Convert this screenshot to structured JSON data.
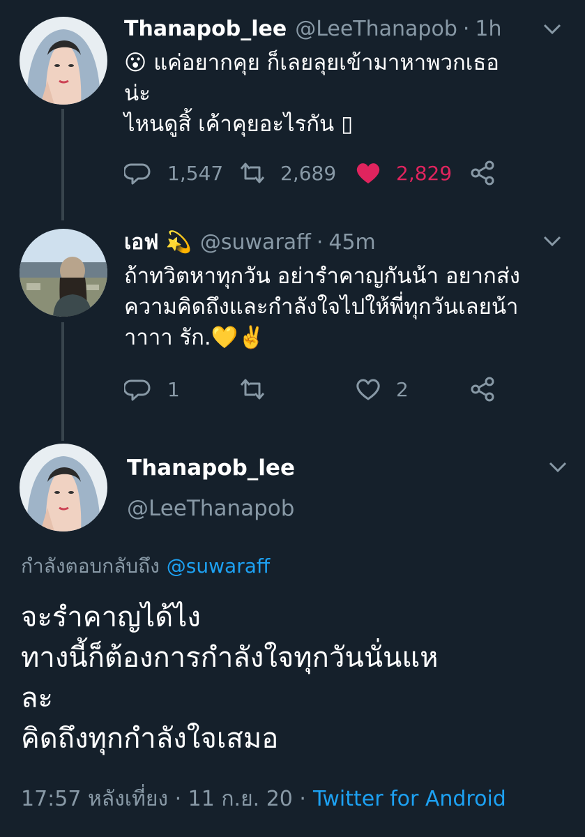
{
  "tweet1": {
    "display_name": "Thanapob_lee",
    "handle": "@LeeThanapob",
    "sep": "·",
    "time": "1h",
    "emoji": "😮",
    "lines": [
      "แค่อยากคุย ก็เลยลุยเข้ามาหาพวกเธอ",
      "น่ะ",
      "ไหนดูสิ้ เค้าคุยอะไรกัน ▯"
    ],
    "replies": "1,547",
    "retweets": "2,689",
    "likes": "2,829",
    "liked": true
  },
  "tweet2": {
    "display_name": "เอฟ",
    "name_emoji": "💫",
    "handle": "@suwaraff",
    "sep": "·",
    "time": "45m",
    "lines": [
      "ถ้าทวิตหาทุกวัน อย่ารำคาญกันน้า อยากส่ง",
      "ความคิดถึงและกำลังใจไปให้พี่ทุกวันเลยน้า",
      "าาาา รัก.💛✌️"
    ],
    "replies": "1",
    "retweets": "",
    "likes": "2",
    "liked": false
  },
  "main_tweet": {
    "display_name": "Thanapob_lee",
    "handle": "@LeeThanapob",
    "replying_label": "กำลังตอบกลับถึง",
    "replying_to": "@suwaraff",
    "lines": [
      "จะรำคาญได้ไง",
      "ทางนี้ก็ต้องการกำลังใจทุกวันนั่นแห",
      "ละ",
      "คิดถึงทุกกำลังใจเสมอ"
    ],
    "timestamp": "17:57 หลังเที่ยง · 11 ก.ย. 20 ·",
    "source": "Twitter for Android"
  },
  "colors": {
    "background": "#15202b",
    "muted": "#8899a6",
    "link": "#1da1f2",
    "like": "#e0245e",
    "thread_line": "#38444d"
  }
}
